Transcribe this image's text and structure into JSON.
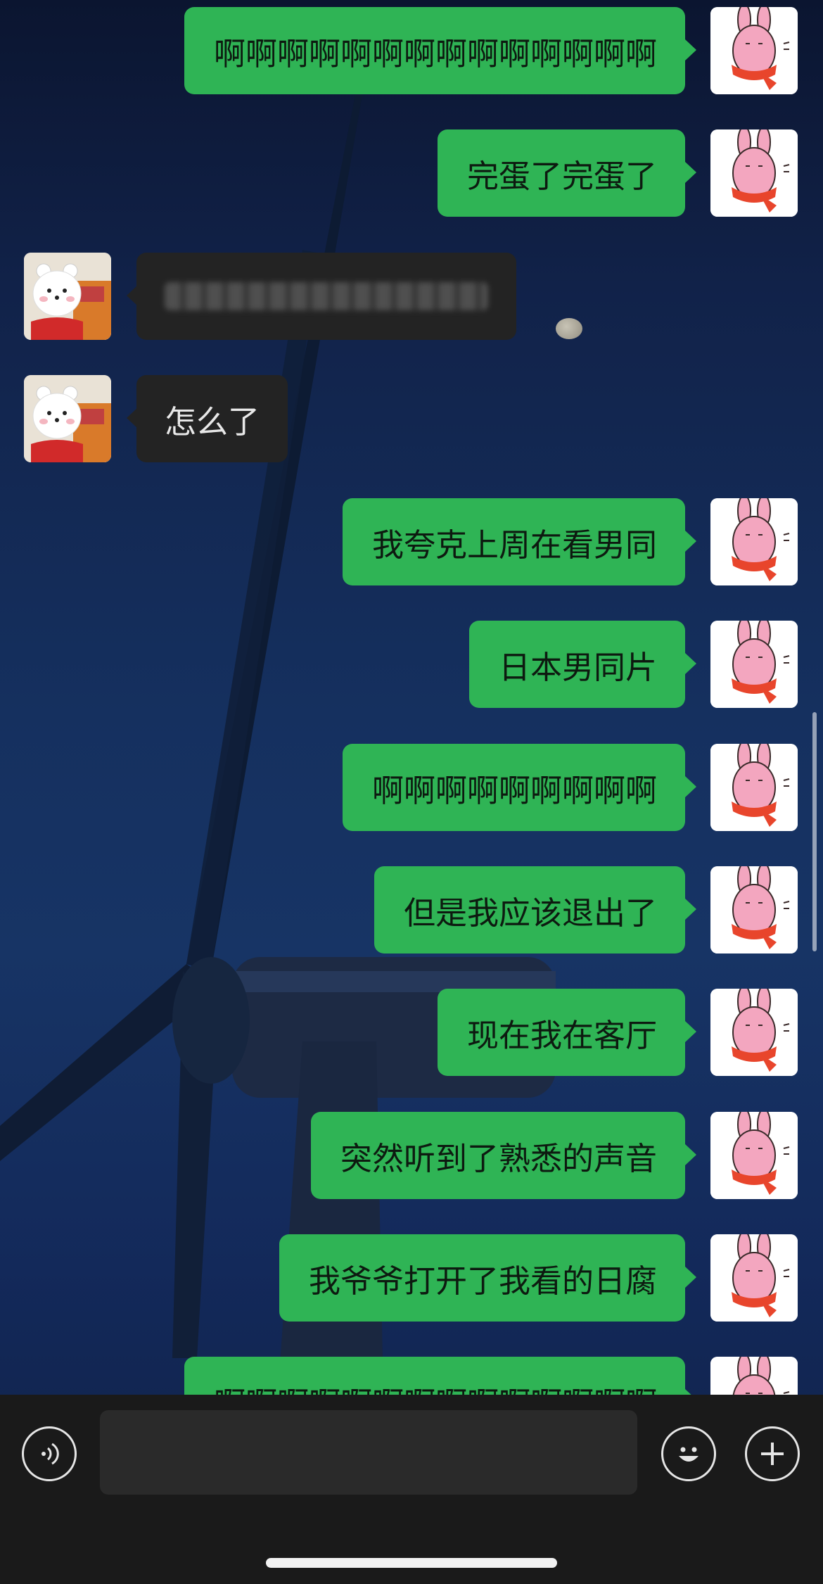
{
  "messages": [
    {
      "side": "right",
      "text": "啊啊啊啊啊啊啊啊啊啊啊啊啊啊",
      "avatar": "pink-rabbit-avatar"
    },
    {
      "side": "right",
      "text": "完蛋了完蛋了",
      "avatar": "pink-rabbit-avatar"
    },
    {
      "side": "left",
      "text": "",
      "avatar": "white-bear-avatar",
      "blurred": true
    },
    {
      "side": "left",
      "text": "怎么了",
      "avatar": "white-bear-avatar"
    },
    {
      "side": "right",
      "text": "我夸克上周在看男同",
      "avatar": "pink-rabbit-avatar"
    },
    {
      "side": "right",
      "text": "日本男同片",
      "avatar": "pink-rabbit-avatar"
    },
    {
      "side": "right",
      "text": "啊啊啊啊啊啊啊啊啊",
      "avatar": "pink-rabbit-avatar"
    },
    {
      "side": "right",
      "text": "但是我应该退出了",
      "avatar": "pink-rabbit-avatar"
    },
    {
      "side": "right",
      "text": "现在我在客厅",
      "avatar": "pink-rabbit-avatar"
    },
    {
      "side": "right",
      "text": "突然听到了熟悉的声音",
      "avatar": "pink-rabbit-avatar"
    },
    {
      "side": "right",
      "text": "我爷爷打开了我看的日腐",
      "avatar": "pink-rabbit-avatar"
    },
    {
      "side": "right",
      "text": "啊啊啊啊啊啊啊啊啊啊啊啊啊啊",
      "avatar": "pink-rabbit-avatar"
    }
  ],
  "input_bar": {
    "voice_icon": "voice-icon",
    "emoji_icon": "emoji-icon",
    "plus_icon": "plus-icon",
    "placeholder": ""
  },
  "colors": {
    "bubble_self": "#2fb455",
    "bubble_other": "#232323",
    "input_bar_bg": "#1a1a1a"
  }
}
